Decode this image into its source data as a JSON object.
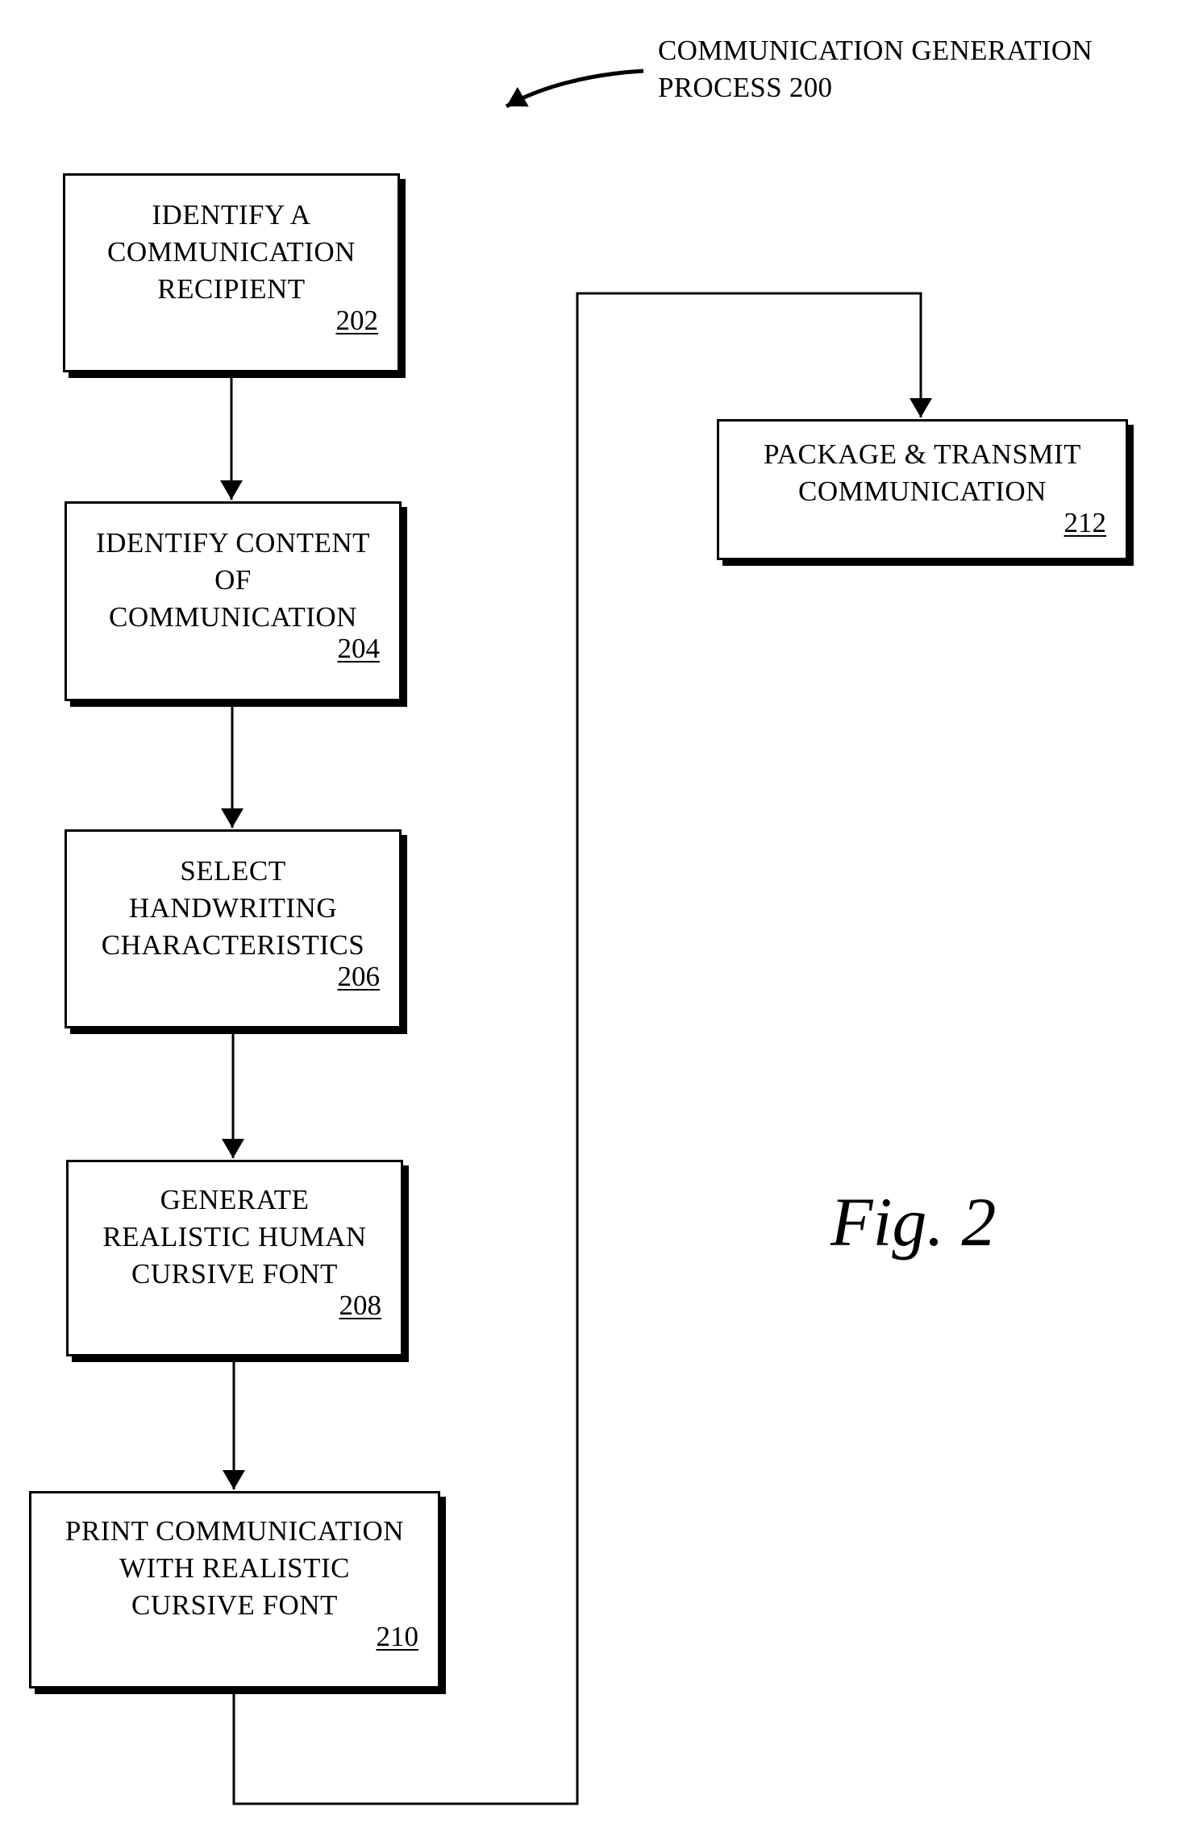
{
  "process_label": {
    "text": "COMMUNICATION GENERATION\nPROCESS 200"
  },
  "figure_label": "Fig. 2",
  "steps": [
    {
      "id": "202",
      "text": "IDENTIFY A\nCOMMUNICATION\nRECIPIENT",
      "ref": "202"
    },
    {
      "id": "204",
      "text": "IDENTIFY CONTENT\nOF\nCOMMUNICATION",
      "ref": "204"
    },
    {
      "id": "206",
      "text": "SELECT\nHANDWRITING\nCHARACTERISTICS",
      "ref": "206"
    },
    {
      "id": "208",
      "text": "GENERATE\nREALISTIC HUMAN\nCURSIVE FONT",
      "ref": "208"
    },
    {
      "id": "210",
      "text": "PRINT COMMUNICATION\nWITH REALISTIC\nCURSIVE FONT",
      "ref": "210"
    },
    {
      "id": "212",
      "text": "PACKAGE & TRANSMIT\nCOMMUNICATION",
      "ref": "212"
    }
  ],
  "flow": [
    {
      "from": "202",
      "to": "204"
    },
    {
      "from": "204",
      "to": "206"
    },
    {
      "from": "206",
      "to": "208"
    },
    {
      "from": "208",
      "to": "210"
    },
    {
      "from": "210",
      "to": "212"
    }
  ],
  "colors": {
    "ink": "#000000",
    "background": "#ffffff"
  }
}
